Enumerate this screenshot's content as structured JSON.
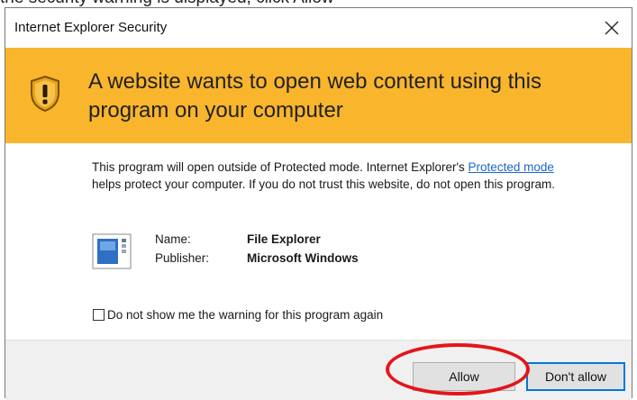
{
  "window": {
    "title": "Internet Explorer Security",
    "close_icon": "close-icon"
  },
  "banner": {
    "headline": "A website wants to open web content using this program on your computer",
    "icon": "shield-warning-icon",
    "color": "#f9b52c"
  },
  "body": {
    "description_part1": "This program will open outside of Protected mode. Internet Explorer's",
    "link_text": "Protected mode",
    "description_part2": "helps protect your computer. If you do not trust this website, do not open this program.",
    "name_label": "Name:",
    "name_value": "File Explorer",
    "publisher_label": "Publisher:",
    "publisher_value": "Microsoft Windows",
    "checkbox_label": "Do not show me the warning for this program again",
    "checkbox_checked": false
  },
  "footer": {
    "allow_label": "Allow",
    "deny_label": "Don't allow"
  },
  "annotation": {
    "color": "#e3151b",
    "target": "Allow"
  },
  "top_cropped_text": "the security warning is displayed, click Allow"
}
